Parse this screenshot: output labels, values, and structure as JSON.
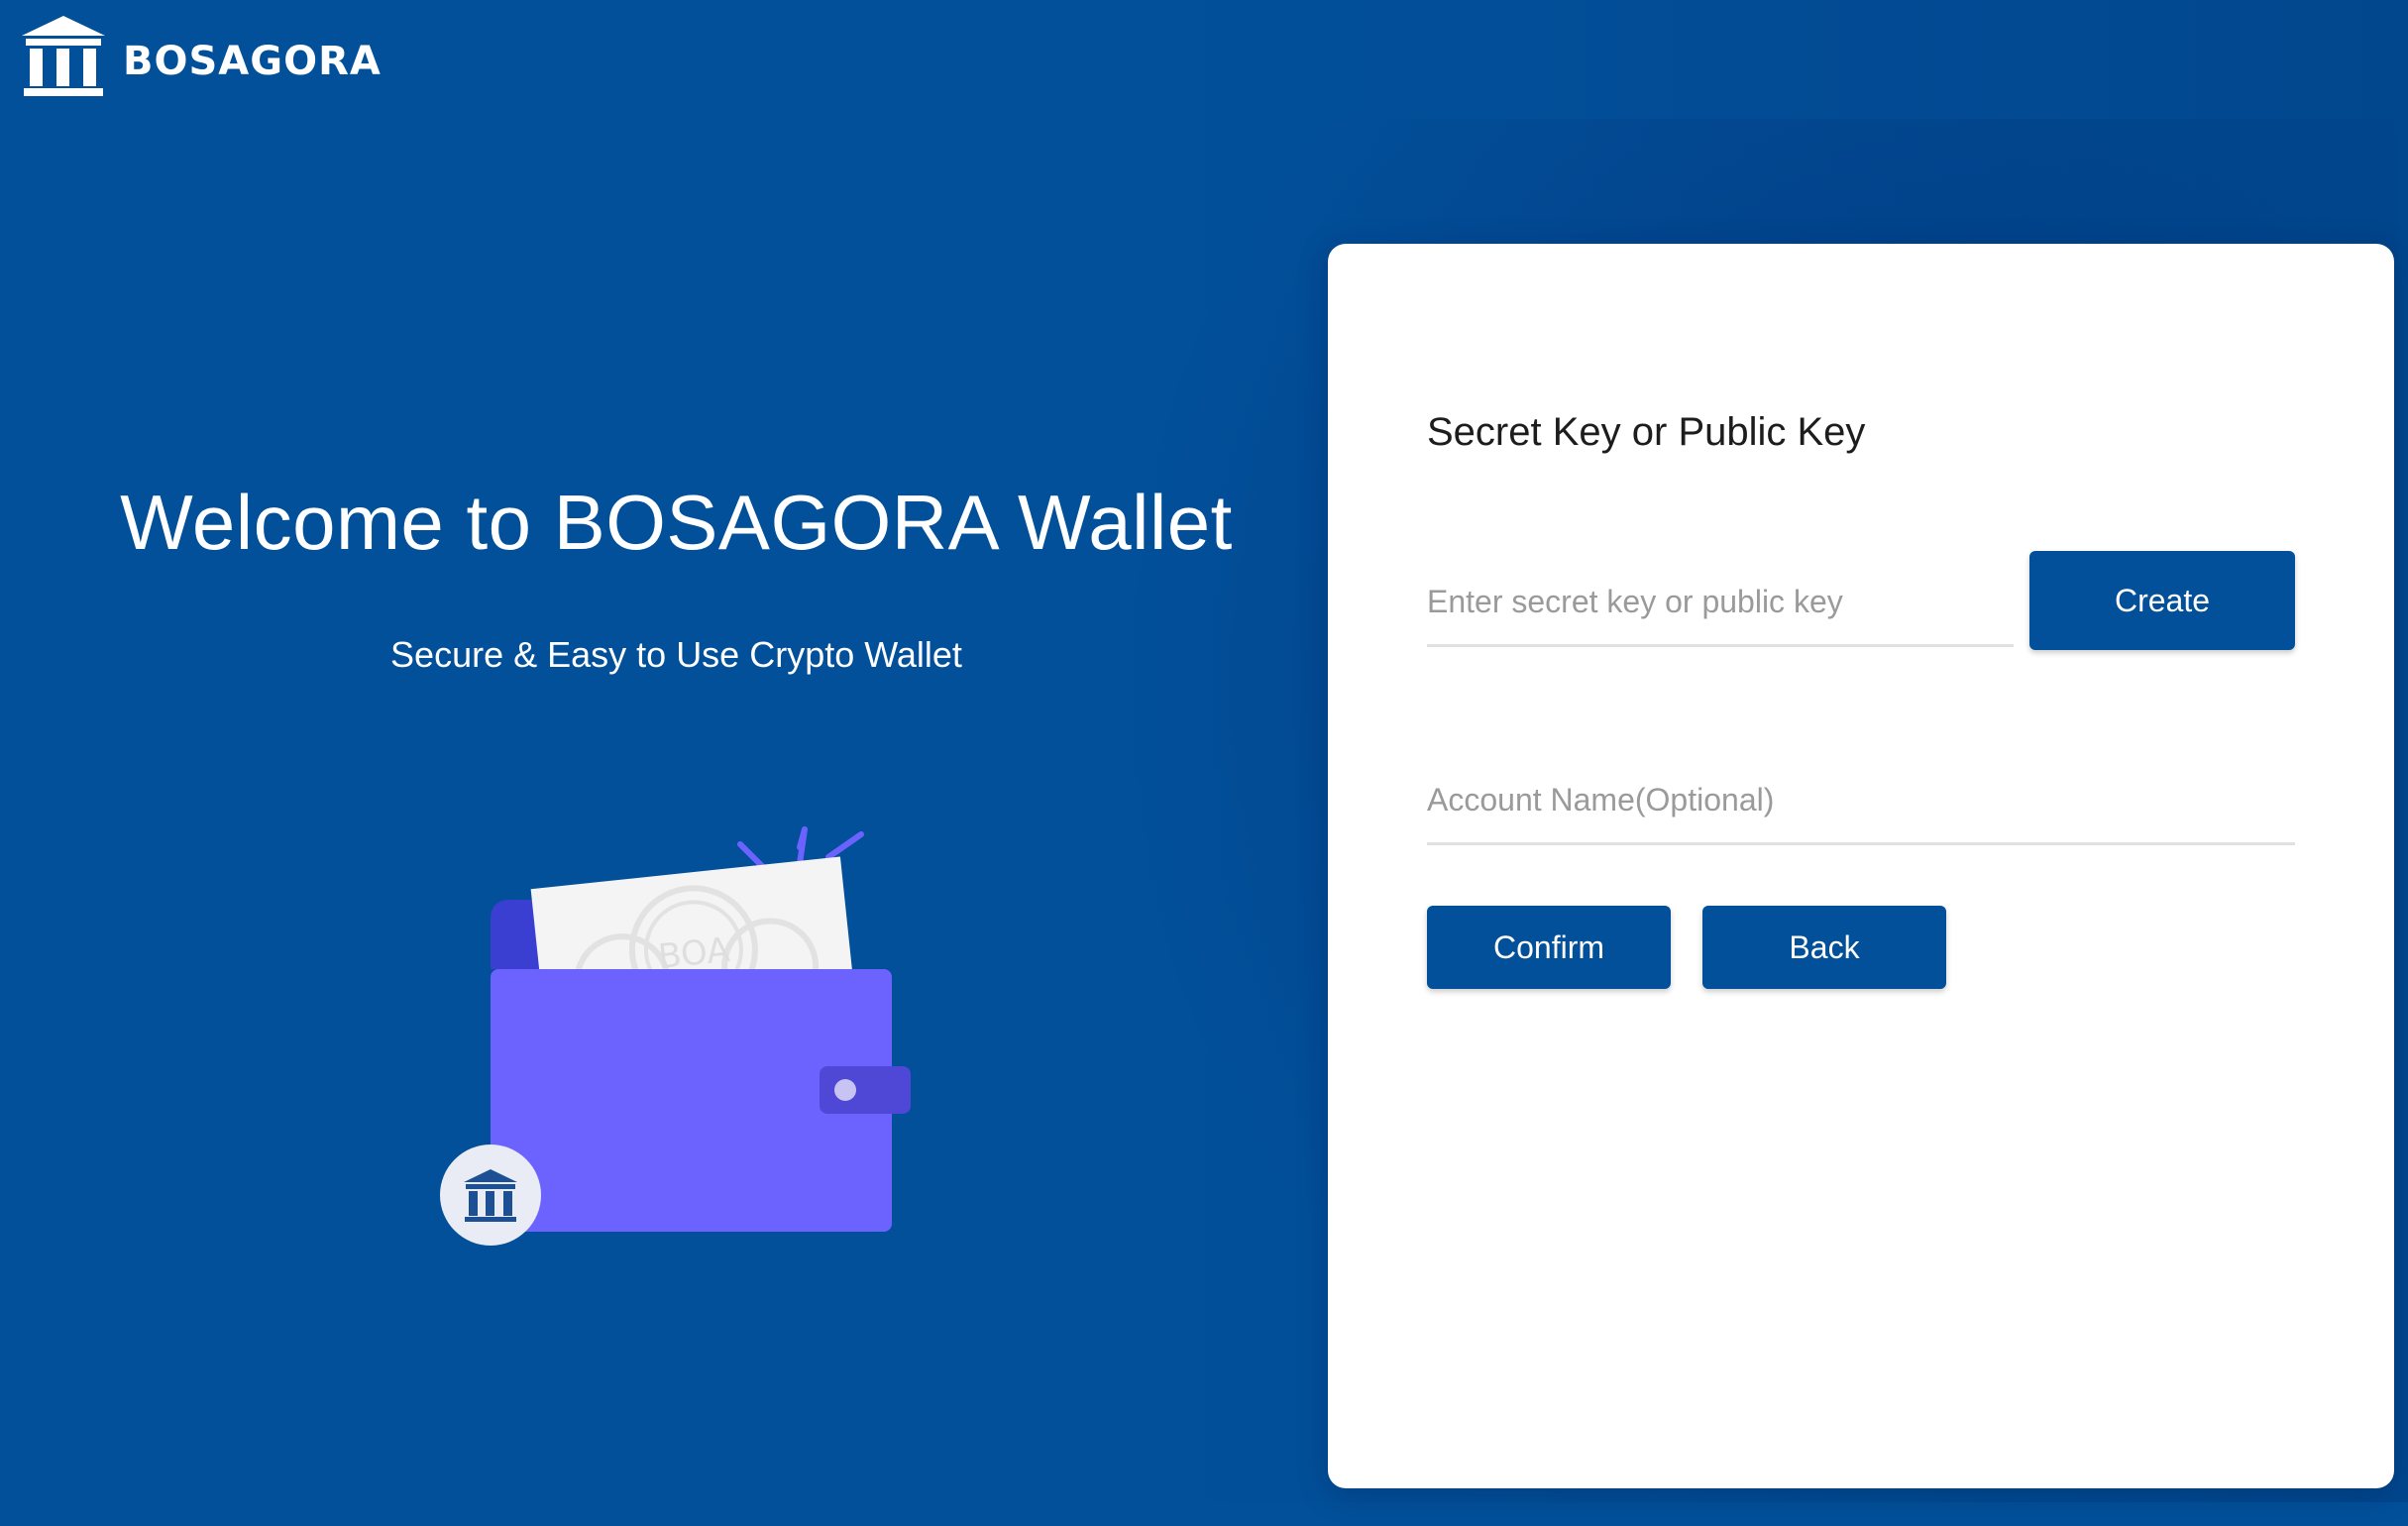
{
  "brand": {
    "name": "BOSAGORA"
  },
  "hero": {
    "title": "Welcome to BOSAGORA Wallet",
    "subtitle": "Secure & Easy to Use Crypto Wallet",
    "card_text": "BOA"
  },
  "form": {
    "title": "Secret Key or Public Key",
    "key_placeholder": "Enter secret key or public key",
    "key_value": "",
    "name_placeholder": "Account Name(Optional)",
    "name_value": "",
    "create_label": "Create",
    "confirm_label": "Confirm",
    "back_label": "Back"
  },
  "colors": {
    "background": "#02509a",
    "button": "#02509a",
    "wallet": "#6c63ff",
    "card": "#ffffff"
  },
  "icons": {
    "logo": "bank-building-icon",
    "wallet": "wallet-illustration",
    "badge": "bank-building-icon"
  }
}
